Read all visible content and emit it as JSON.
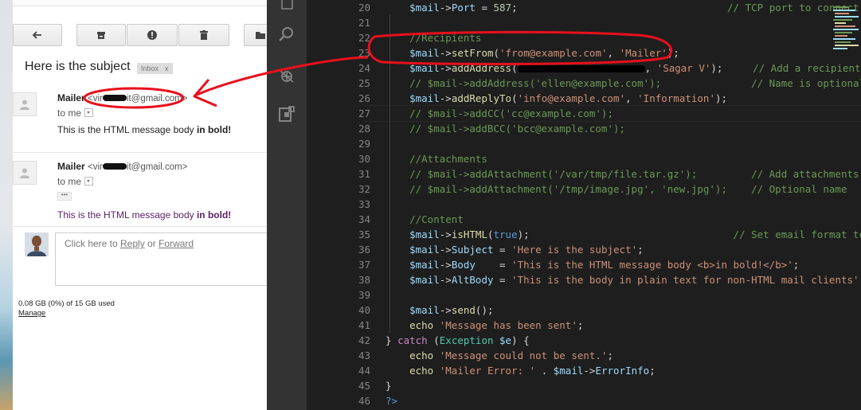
{
  "gmail": {
    "toolbar": [
      {
        "icon": "back-arrow-icon"
      },
      {
        "icon": "archive-icon"
      },
      {
        "icon": "report-spam-icon"
      },
      {
        "icon": "delete-icon"
      },
      {
        "icon": "folder-icon"
      }
    ],
    "subject": "Here is the subject",
    "label_tag": "Inbox",
    "label_close": "x",
    "messages": [
      {
        "sender_name": "Mailer",
        "sender_email_prefix": "<vir",
        "sender_email_suffix": "it@gmail.com>",
        "to": "to me",
        "body_plain": "This is the HTML message body ",
        "body_bold": "in bold!"
      },
      {
        "sender_name": "Mailer",
        "sender_email_prefix": "<vir",
        "sender_email_suffix": "it@gmail.com>",
        "to": "to me",
        "body_plain": "This is the HTML message body ",
        "body_bold": "in bold!"
      }
    ],
    "reply": {
      "prefix": "Click here to ",
      "reply_link": "Reply",
      "middle": " or ",
      "forward_link": "Forward"
    },
    "storage": "0.08 GB (0%) of 15 GB used",
    "manage": "Manage"
  },
  "editor": {
    "line_numbers": [
      "20",
      "21",
      "22",
      "23",
      "24",
      "25",
      "26",
      "27",
      "28",
      "29",
      "30",
      "31",
      "32",
      "33",
      "34",
      "35",
      "36",
      "37",
      "38",
      "39",
      "40",
      "41",
      "42",
      "43",
      "44",
      "45",
      "46"
    ],
    "activity_icons": [
      "files-icon",
      "search-icon",
      "debug-icon",
      "extensions-icon"
    ],
    "colors": {
      "background": "#1e1e1e",
      "activity_bar": "#333333",
      "annotation": "#e8101c"
    }
  }
}
